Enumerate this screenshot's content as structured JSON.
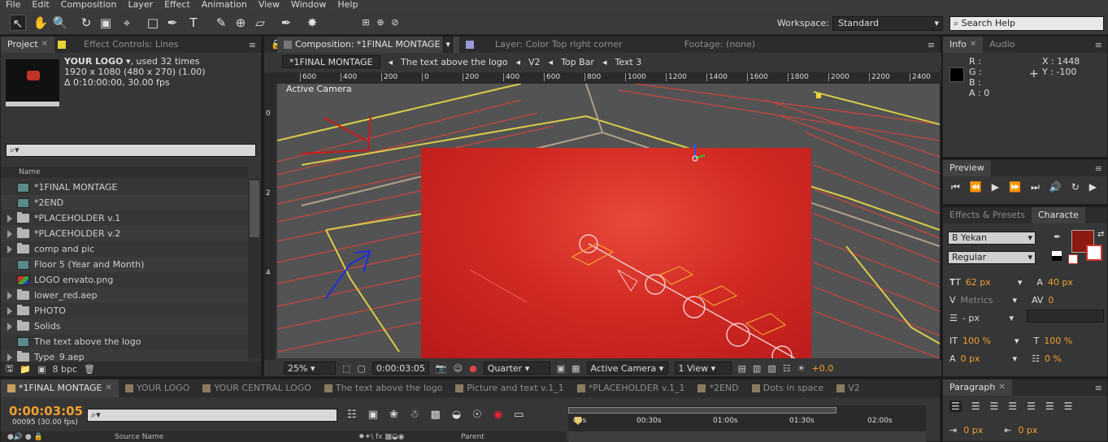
{
  "menu": [
    "File",
    "Edit",
    "Composition",
    "Layer",
    "Effect",
    "Animation",
    "View",
    "Window",
    "Help"
  ],
  "workspace": {
    "label": "Workspace:",
    "value": "Standard",
    "search_placeholder": "Search Help"
  },
  "project_panel": {
    "tabs": [
      {
        "label": "Project"
      },
      {
        "label": "Effect Controls: Lines"
      }
    ],
    "selected_name": "YOUR LOGO",
    "used_text": ", used 32 times",
    "dims": "1920 x 1080  (480 x 270) (1.00)",
    "duration": "Δ 0:10:00:00, 30.00 fps",
    "search_placeholder": "⌕▾",
    "column_name": "Name",
    "items": [
      {
        "type": "comp",
        "label": "*1FINAL MONTAGE"
      },
      {
        "type": "comp",
        "label": "*2END"
      },
      {
        "type": "folder",
        "label": "*PLACEHOLDER v.1"
      },
      {
        "type": "folder",
        "label": "*PLACEHOLDER v.2"
      },
      {
        "type": "folder",
        "label": "comp and pic"
      },
      {
        "type": "comp",
        "label": "Floor 5 (Year and Month)"
      },
      {
        "type": "img",
        "label": "LOGO envato.png"
      },
      {
        "type": "folder",
        "label": "lower_red.aep"
      },
      {
        "type": "folder",
        "label": "PHOTO"
      },
      {
        "type": "folder",
        "label": "Solids"
      },
      {
        "type": "comp",
        "label": "The text above the logo"
      },
      {
        "type": "folder",
        "label": "Type_9.aep"
      }
    ],
    "bpc": "8 bpc"
  },
  "comp_panel": {
    "tabs": [
      {
        "label": "Composition: *1FINAL MONTAGE"
      },
      {
        "label": "Layer: Color Top right corner"
      },
      {
        "label": "Footage: (none)"
      }
    ],
    "breadcrumbs": [
      "*1FINAL MONTAGE",
      "The text above the logo",
      "V2",
      "Top Bar",
      "Text 3"
    ],
    "ruler_ticks": [
      "600",
      "400",
      "200",
      "0",
      "200",
      "400",
      "600",
      "800",
      "1000",
      "1200",
      "1400",
      "1600",
      "1800",
      "2000",
      "2200",
      "2400"
    ],
    "v_ruler_ticks": [
      "0",
      "2",
      "4"
    ],
    "camera_label": "Active Camera",
    "zoom": "25%",
    "timecode": "0:00:03:05",
    "resolution": "Quarter",
    "view_camera": "Active Camera",
    "view_count": "1 View",
    "exposure": "+0.0"
  },
  "info_panel": {
    "tabs": [
      {
        "label": "Info"
      },
      {
        "label": "Audio"
      }
    ],
    "r": "R :",
    "g": "G :",
    "b": "B :",
    "a": "A : 0",
    "x": "X : 1448",
    "y": "Y : -100"
  },
  "preview_panel": {
    "title": "Preview"
  },
  "char_panel": {
    "tabs": [
      {
        "label": "Effects & Presets"
      },
      {
        "label": "Characte"
      }
    ],
    "font": "B Yekan",
    "style": "Regular",
    "size": "62 px",
    "leading": "40 px",
    "kerning": "Metrics",
    "tracking": "0",
    "stroke": "- px",
    "vscale": "100 %",
    "hscale": "100 %",
    "baseline": "0 px",
    "tsume": "0 %",
    "fill_color": "#8b1a10"
  },
  "paragraph_panel": {
    "title": "Paragraph",
    "indent_left": "0 px",
    "indent_right": "0 px"
  },
  "timeline": {
    "tabs": [
      "*1FINAL MONTAGE",
      "YOUR LOGO",
      "YOUR CENTRAL LOGO",
      "The text above the logo",
      "Picture and text v.1_1",
      "*PLACEHOLDER v.1_1",
      "*2END",
      "Dots in space",
      "V2"
    ],
    "timecode": "0:00:03:05",
    "frames": "00095 (30.00 fps)",
    "search_placeholder": "⌕▾",
    "time_marks": [
      "00s",
      "00:30s",
      "01:00s",
      "01:30s",
      "02:00s"
    ],
    "col_source": "Source Name",
    "col_parent": "Parent"
  }
}
